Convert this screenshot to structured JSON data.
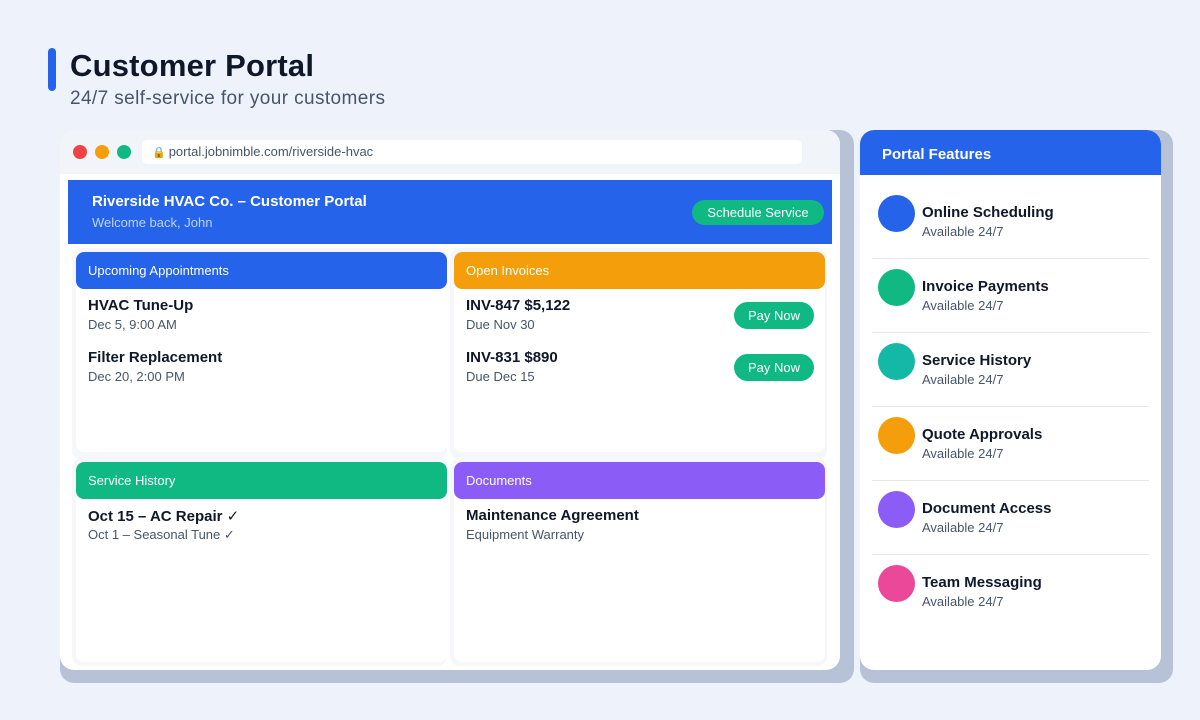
{
  "header": {
    "title": "Customer Portal",
    "subtitle": "24/7 self-service for your customers"
  },
  "browser": {
    "url": "portal.jobnimble.com/riverside-hvac",
    "lock_glyph": "🔒"
  },
  "portal": {
    "name": "Riverside HVAC Co. – Customer Portal",
    "welcome": "Welcome back, John",
    "schedule_label": "Schedule Service"
  },
  "panels": {
    "appointments": {
      "title": "Upcoming Appointments",
      "color": "#2563eb",
      "items": [
        {
          "title": "HVAC Tune-Up",
          "sub": "Dec 5, 9:00 AM"
        },
        {
          "title": "Filter Replacement",
          "sub": "Dec 20, 2:00 PM"
        }
      ]
    },
    "invoices": {
      "title": "Open Invoices",
      "color": "#f59e0b",
      "items": [
        {
          "title": "INV-847 $5,122",
          "sub": "Due Nov 30",
          "action": "Pay Now"
        },
        {
          "title": "INV-831 $890",
          "sub": "Due Dec 15",
          "action": "Pay Now"
        }
      ]
    },
    "history": {
      "title": "Service History",
      "color": "#10b981",
      "items": [
        {
          "title": "Oct 15 – AC Repair ✓",
          "sub": "Oct 1 – Seasonal Tune ✓"
        }
      ]
    },
    "documents": {
      "title": "Documents",
      "color": "#8b5cf6",
      "items": [
        {
          "title": "Maintenance Agreement",
          "sub": "Equipment Warranty"
        }
      ]
    }
  },
  "features": {
    "title": "Portal Features",
    "items": [
      {
        "name": "Online Scheduling",
        "availability": "Available 24/7",
        "color": "#2563eb"
      },
      {
        "name": "Invoice Payments",
        "availability": "Available 24/7",
        "color": "#10b981"
      },
      {
        "name": "Service History",
        "availability": "Available 24/7",
        "color": "#14b8a6"
      },
      {
        "name": "Quote Approvals",
        "availability": "Available 24/7",
        "color": "#f59e0b"
      },
      {
        "name": "Document Access",
        "availability": "Available 24/7",
        "color": "#8b5cf6"
      },
      {
        "name": "Team Messaging",
        "availability": "Available 24/7",
        "color": "#ec4899"
      }
    ]
  }
}
